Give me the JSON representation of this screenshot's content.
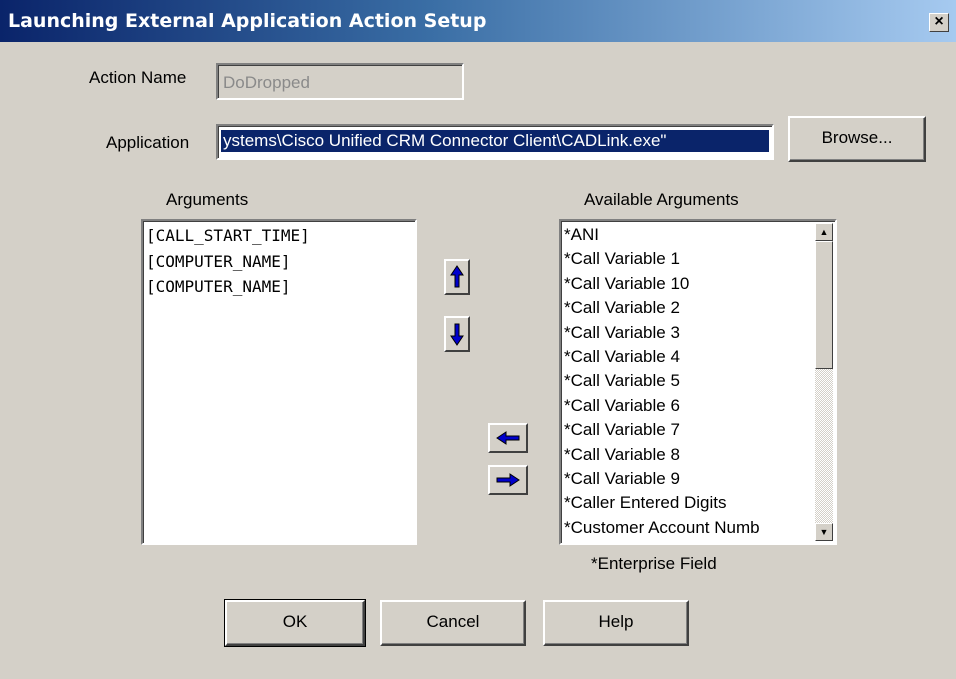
{
  "window": {
    "title": "Launching External Application Action Setup",
    "close_glyph": "×",
    "title_gradient": [
      "#0a246a",
      "#a6caf0"
    ]
  },
  "action_name": {
    "label": "Action Name",
    "value": "DoDropped"
  },
  "application": {
    "label": "Application",
    "value": "ystems\\Cisco Unified CRM Connector Client\\CADLink.exe\"",
    "browse_label": "Browse..."
  },
  "arguments": {
    "label": "Arguments",
    "items": [
      "[CALL_START_TIME]",
      "[COMPUTER_NAME]",
      "[COMPUTER_NAME]"
    ]
  },
  "available_arguments": {
    "label": "Available Arguments",
    "items": [
      "*ANI",
      "*Call Variable 1",
      "*Call Variable 10",
      "*Call Variable 2",
      "*Call Variable 3",
      "*Call Variable 4",
      "*Call Variable 5",
      "*Call Variable 6",
      "*Call Variable 7",
      "*Call Variable 8",
      "*Call Variable 9",
      "*Caller Entered Digits",
      "*Customer Account Numb"
    ],
    "footnote": "*Enterprise Field"
  },
  "buttons": {
    "ok": "OK",
    "cancel": "Cancel",
    "help": "Help"
  },
  "icons": {
    "move_up": "arrow-up-icon",
    "move_down": "arrow-down-icon",
    "add_left": "arrow-left-icon",
    "remove_right": "arrow-right-icon",
    "arrow_color": "#0000cc"
  }
}
